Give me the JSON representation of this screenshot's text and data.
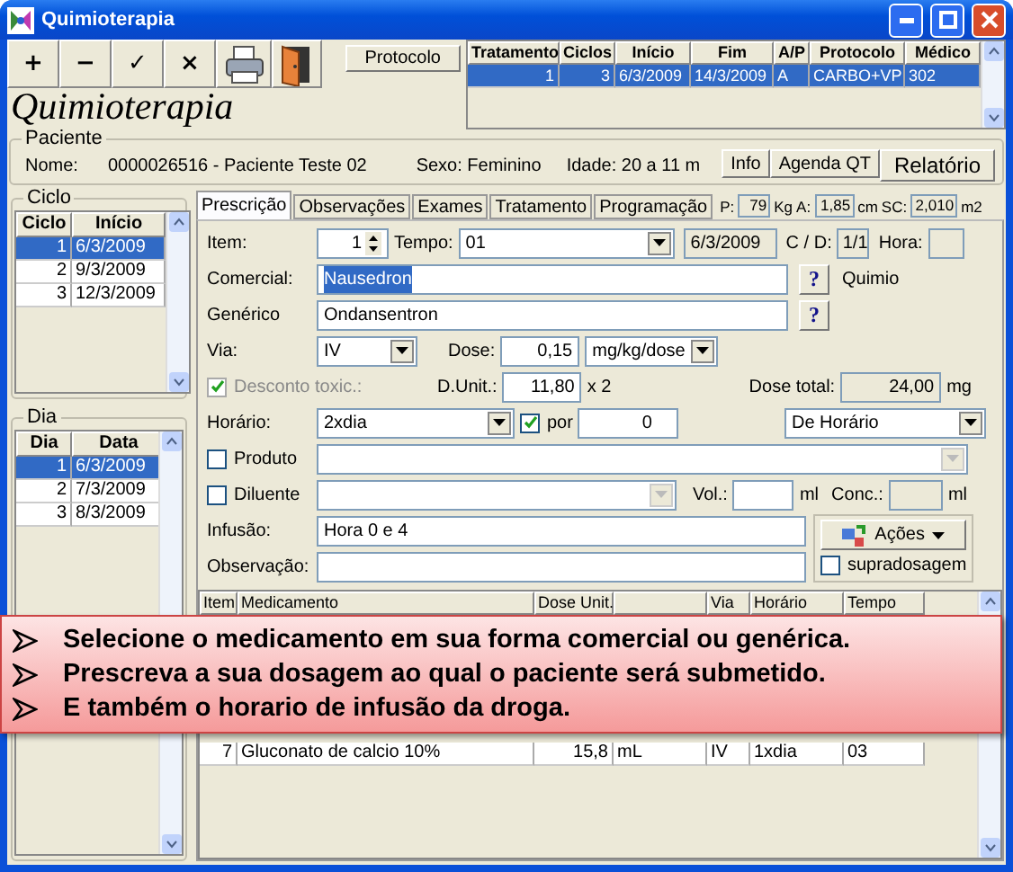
{
  "window": {
    "title": "Quimioterapia"
  },
  "toolbar": {
    "buttons": [
      {
        "kind": "text",
        "label": "+"
      },
      {
        "kind": "text",
        "label": "−"
      },
      {
        "kind": "text",
        "label": "✓"
      },
      {
        "kind": "text",
        "label": "×"
      },
      {
        "kind": "printer"
      },
      {
        "kind": "door"
      }
    ],
    "heading": "Quimioterapia",
    "protocol_button": "Protocolo"
  },
  "treatments": {
    "columns": [
      "Tratamento",
      "Ciclos",
      "Início",
      "Fim",
      "A/P",
      "Protocolo",
      "Médico"
    ],
    "rows": [
      {
        "selected": true,
        "cells": [
          "1",
          "3",
          "6/3/2009",
          "14/3/2009",
          "A",
          "CARBO+VP",
          "302"
        ]
      }
    ]
  },
  "patient": {
    "legend": "Paciente",
    "name_label": "Nome:",
    "name": "0000026516 - Paciente Teste 02",
    "sex": "Sexo: Feminino",
    "age": "Idade: 20 a 11 m",
    "buttons": [
      "Info",
      "Agenda QT",
      "Relatório"
    ]
  },
  "cycles": {
    "legend": "Ciclo",
    "columns": [
      "Ciclo",
      "Início"
    ],
    "rows": [
      {
        "selected": true,
        "cells": [
          "1",
          "6/3/2009"
        ]
      },
      {
        "selected": false,
        "cells": [
          "2",
          "9/3/2009"
        ]
      },
      {
        "selected": false,
        "cells": [
          "3",
          "12/3/2009"
        ]
      }
    ]
  },
  "days": {
    "legend": "Dia",
    "columns": [
      "Dia",
      "Data"
    ],
    "rows": [
      {
        "selected": true,
        "cells": [
          "1",
          "6/3/2009"
        ]
      },
      {
        "selected": false,
        "cells": [
          "2",
          "7/3/2009"
        ]
      },
      {
        "selected": false,
        "cells": [
          "3",
          "8/3/2009"
        ]
      }
    ]
  },
  "tabs": [
    {
      "label": "Prescrição",
      "selected": true
    },
    {
      "label": "Observações",
      "selected": false
    },
    {
      "label": "Exames",
      "selected": false
    },
    {
      "label": "Tratamento",
      "selected": false
    },
    {
      "label": "Programação",
      "selected": false
    }
  ],
  "measures": [
    {
      "label": "P:",
      "value": "79",
      "unit": "Kg"
    },
    {
      "label": "A:",
      "value": "1,85",
      "unit": "cm"
    },
    {
      "label": "SC:",
      "value": "2,010",
      "unit": "m2"
    }
  ],
  "form": {
    "item_label": "Item:",
    "item": "1",
    "tempo_label": "Tempo:",
    "tempo": "01",
    "date": "6/3/2009",
    "cd_label": "C / D:",
    "cd": "1/1",
    "hora_label": "Hora:",
    "comercial_label": "Comercial:",
    "comercial": "Nausedron",
    "help": "?",
    "quimio": "Quimio",
    "generico_label": "Genérico",
    "generico": "Ondansentron",
    "via_label": "Via:",
    "via": "IV",
    "dose_label": "Dose:",
    "dose": "0,15",
    "dose_unit": "mg/kg/dose",
    "desconto": {
      "label": "Desconto toxic.:",
      "checked": true,
      "disabled": true
    },
    "dunit_label": "D.Unit.:",
    "dunit": "11,80",
    "times": "x 2",
    "total_label": "Dose total:",
    "total": "24,00",
    "total_unit": "mg",
    "horario_label": "Horário:",
    "horario": "2xdia",
    "por": {
      "label": "por",
      "checked": true
    },
    "por_value": "0",
    "modo": "De Horário",
    "produto": {
      "label": "Produto",
      "checked": false
    },
    "diluente": {
      "label": "Diluente",
      "checked": false
    },
    "vol_label": "Vol.:",
    "vol_unit": "ml",
    "conc_label": "Conc.:",
    "conc_unit": "ml",
    "infusao_label": "Infusão:",
    "infusao": "Hora 0 e 4",
    "acoes": "Ações",
    "observacao_label": "Observação:",
    "supradosagem": {
      "label": "supradosagem",
      "checked": false
    }
  },
  "medications": {
    "columns": [
      {
        "kind": "label",
        "label": "Item"
      },
      {
        "kind": "label",
        "label": "Medicamento"
      },
      {
        "kind": "label",
        "label": "Dose Unit."
      },
      {
        "kind": "blank"
      },
      {
        "kind": "label",
        "label": "Via"
      },
      {
        "kind": "label",
        "label": "Horário"
      },
      {
        "kind": "label",
        "label": "Tempo"
      }
    ],
    "rows": [
      {
        "cells": [
          "7",
          "Gluconato de calcio 10%",
          "15,8",
          "mL",
          "IV",
          "1xdia",
          "03"
        ]
      }
    ]
  },
  "callout": [
    "Selecione o medicamento em sua forma comercial ou genérica.",
    "Prescreva a sua dosagem ao qual o paciente será submetido.",
    "E também o horario de infusão da droga."
  ]
}
